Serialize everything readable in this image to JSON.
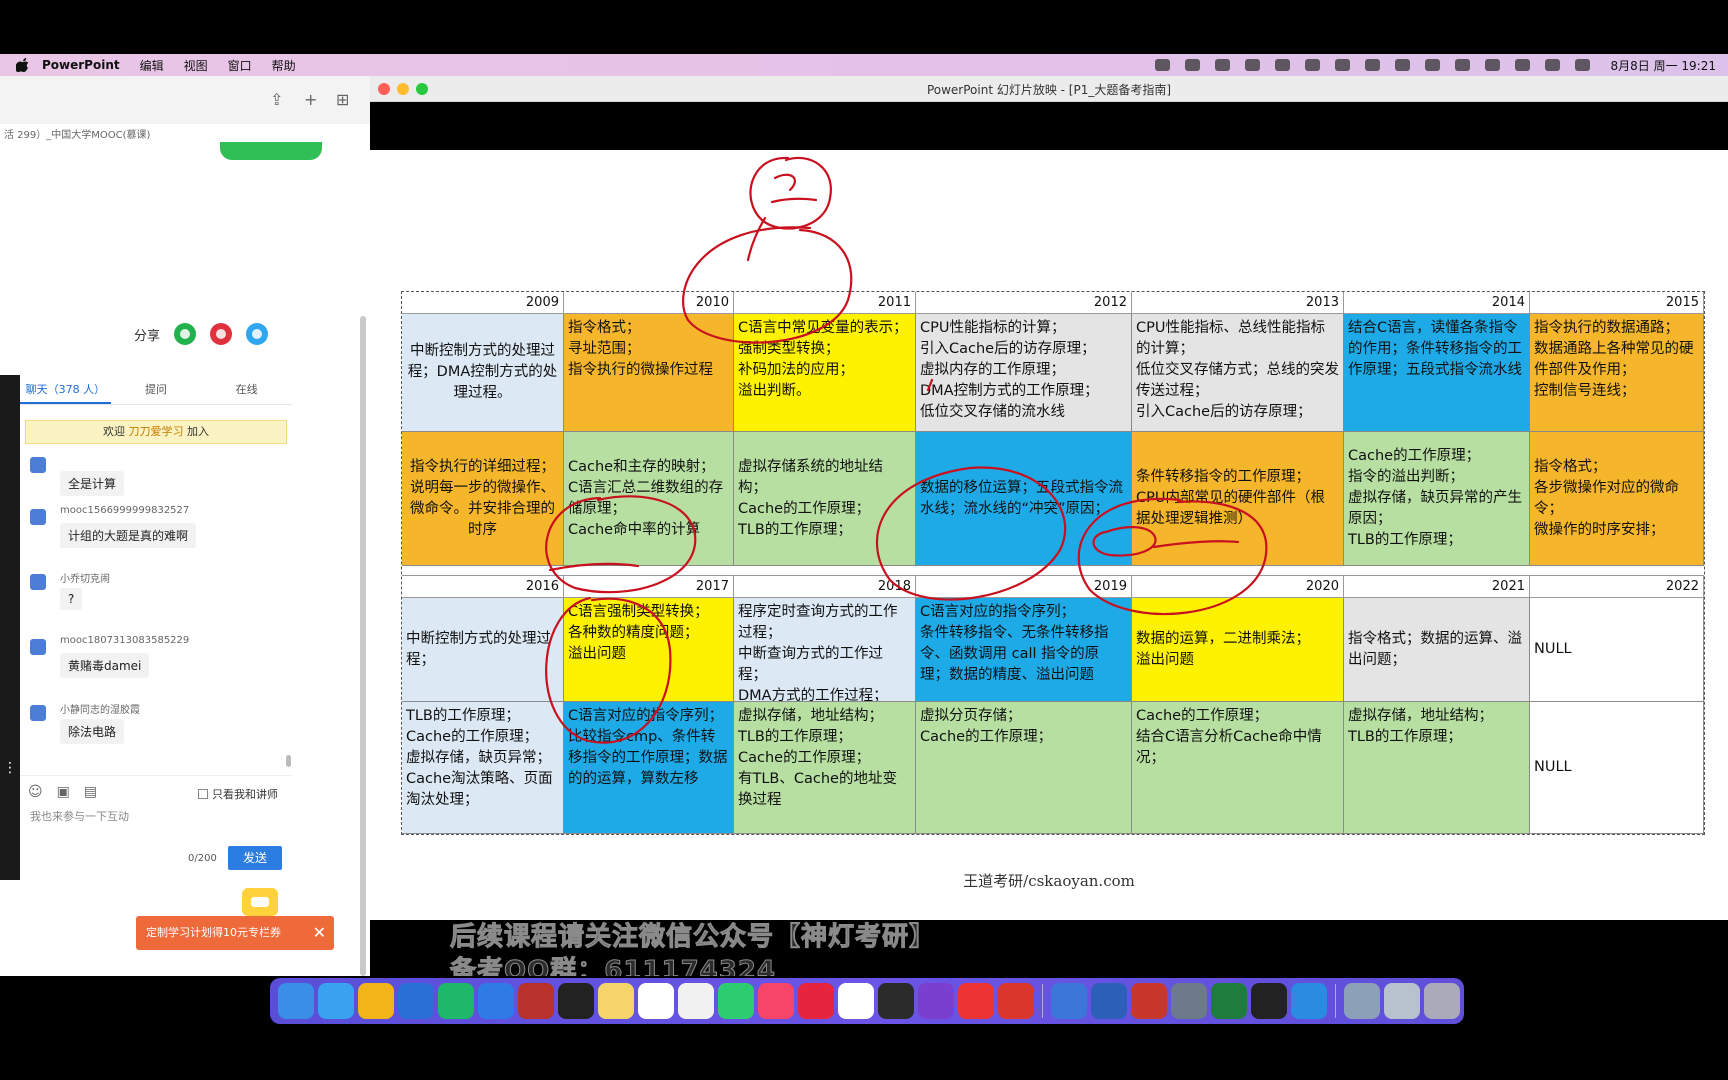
{
  "menubar": {
    "app_name": "PowerPoint",
    "items": [
      "编辑",
      "视图",
      "窗口",
      "帮助"
    ],
    "clock": "8月8日 周一  19:21"
  },
  "browser": {
    "url_text": "活 299）_中国大学MOOC(慕课)",
    "share_label": "分享"
  },
  "chat": {
    "tabs": [
      "聊天（378 人）",
      "提问",
      "在线"
    ],
    "welcome_prefix": "欢迎",
    "welcome_name": "刀刀爱学习",
    "welcome_suffix": "加入",
    "messages": [
      {
        "user": "",
        "text": "全是计算"
      },
      {
        "user": "mooc1566999999832527",
        "text": "计组的大题是真的难啊"
      },
      {
        "user": "小乔切克闹",
        "text": "?"
      },
      {
        "user": "mooc1807313083585229",
        "text": "黄赌毒damei"
      },
      {
        "user": "小静同志的湿胶霞",
        "text": "除法电路"
      }
    ],
    "only_teacher_label": "只看我和讲师",
    "input_placeholder": "我也来参与一下互动",
    "char_count": "0/200",
    "send_label": "发送"
  },
  "coupon": {
    "text": "定制学习计划得10元专栏券",
    "close": "✕"
  },
  "ppt": {
    "window_title": "PowerPoint 幻灯片放映 - [P1_大题备考指南]",
    "watermark": "王道考研/cskaoyan.com",
    "overlay_line1": "后续课程请关注微信公众号【神灯考研】",
    "overlay_line2": "备考QQ群：611174324"
  },
  "table": {
    "years_top": [
      "2009",
      "2010",
      "2011",
      "2012",
      "2013",
      "2014",
      "2015"
    ],
    "row1": [
      "中断控制方式的处理过程；DMA控制方式的处理过程。",
      "指令格式；\n寻址范围；\n指令执行的微操作过程",
      "C语言中常见变量的表示；强制类型转换；\n补码加法的应用；\n溢出判断。",
      "CPU性能指标的计算；\n引入Cache后的访存原理；\n虚拟内存的工作原理；\nDMA控制方式的工作原理；\n低位交叉存储的流水线",
      "CPU性能指标、总线性能指标的计算；\n低位交叉存储方式；总线的突发传送过程；\n引入Cache后的访存原理；",
      "结合C语言，读懂各条指令的作用；条件转移指令的工作原理；五段式指令流水线",
      "指令执行的数据通路；\n数据通路上各种常见的硬件部件及作用；\n控制信号连线；"
    ],
    "row2": [
      "指令执行的详细过程；说明每一步的微操作、微命令。并安排合理的时序",
      "Cache和主存的映射；\nC语言汇总二维数组的存储原理；\nCache命中率的计算",
      "虚拟存储系统的地址结构；\nCache的工作原理；\nTLB的工作原理；",
      "数据的移位运算；五段式指令流水线；流水线的“冲突”原因；",
      "条件转移指令的工作原理；\nCPU内部常见的硬件部件（根据处理逻辑推测）",
      "Cache的工作原理；\n指令的溢出判断；\n虚拟存储，缺页异常的产生原因；\nTLB的工作原理；",
      "指令格式；\n各步微操作对应的微命令；\n微操作的时序安排；"
    ],
    "years_bottom": [
      "2016",
      "2017",
      "2018",
      "2019",
      "2020",
      "2021",
      "2022"
    ],
    "row3": [
      "中断控制方式的处理过程；",
      "C语言强制类型转换；\n各种数的精度问题；\n溢出问题",
      "程序定时查询方式的工作过程；\n中断查询方式的工作过程；\nDMA方式的工作过程；",
      "C语言对应的指令序列；\n条件转移指令、无条件转移指令、函数调用 call 指令的原理；数据的精度、溢出问题",
      "数据的运算，二进制乘法；\n溢出问题",
      "指令格式；数据的运算、溢出问题；",
      "NULL"
    ],
    "row4": [
      "TLB的工作原理；\nCache的工作原理；\n虚拟存储，缺页异常；\nCache淘汰策略、页面淘汰处理；",
      "C语言对应的指令序列；比较指令cmp、条件转移指令的工作原理；数据的的运算，算数左移",
      "虚拟存储，地址结构；\nTLB的工作原理；\nCache的工作原理；\n有TLB、Cache的地址变换过程",
      "虚拟分页存储；\nCache的工作原理；",
      "Cache的工作原理；\n结合C语言分析Cache命中情况；",
      "虚拟存储，地址结构；\nTLB的工作原理；",
      "NULL"
    ],
    "colors": {
      "row1": [
        "#dce9f5",
        "#f6b62b",
        "#fef200",
        "#e4e4e4",
        "#e4e4e4",
        "#1eaae7",
        "#f6b62b"
      ],
      "row2": [
        "#f6b62b",
        "#b7dfa1",
        "#b7dfa1",
        "#1eaae7",
        "#f6b62b",
        "#b7dfa1",
        "#f6b62b"
      ],
      "row3": [
        "#dce9f5",
        "#fef200",
        "#dce9f5",
        "#1eaae7",
        "#fef200",
        "#e4e4e4",
        "#ffffff"
      ],
      "row4": [
        "#dce9f5",
        "#1eaae7",
        "#b7dfa1",
        "#b7dfa1",
        "#b7dfa1",
        "#b7dfa1",
        "#ffffff"
      ]
    }
  },
  "annotation_color": "#c8101e"
}
